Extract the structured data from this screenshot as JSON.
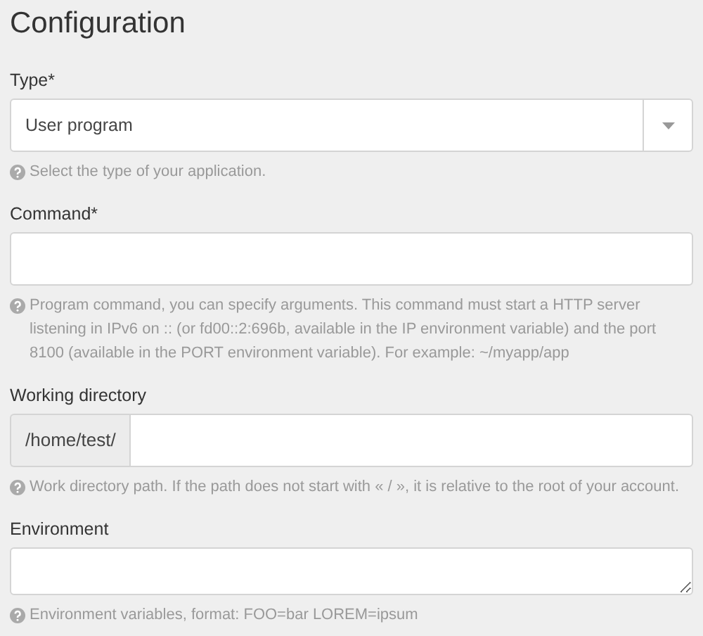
{
  "title": "Configuration",
  "fields": [
    {
      "kind": "select",
      "label": "Type*",
      "value": "User program",
      "help": "Select the type of your application."
    },
    {
      "kind": "text",
      "label": "Command*",
      "help": "Program command, you can specify arguments. This command must start a HTTP server listening in IPv6 on :: (or fd00::2:696b, available in the IP environment variable) and the port 8100 (available in the PORT environment variable). For example: ~/myapp/app"
    },
    {
      "kind": "prefixed",
      "label": "Working directory",
      "prefix": "/home/test/",
      "help": "Work directory path. If the path does not start with « / », it is relative to the root of your account."
    },
    {
      "kind": "textarea",
      "label": "Environment",
      "help": "Environment variables, format: FOO=bar LOREM=ipsum"
    }
  ]
}
